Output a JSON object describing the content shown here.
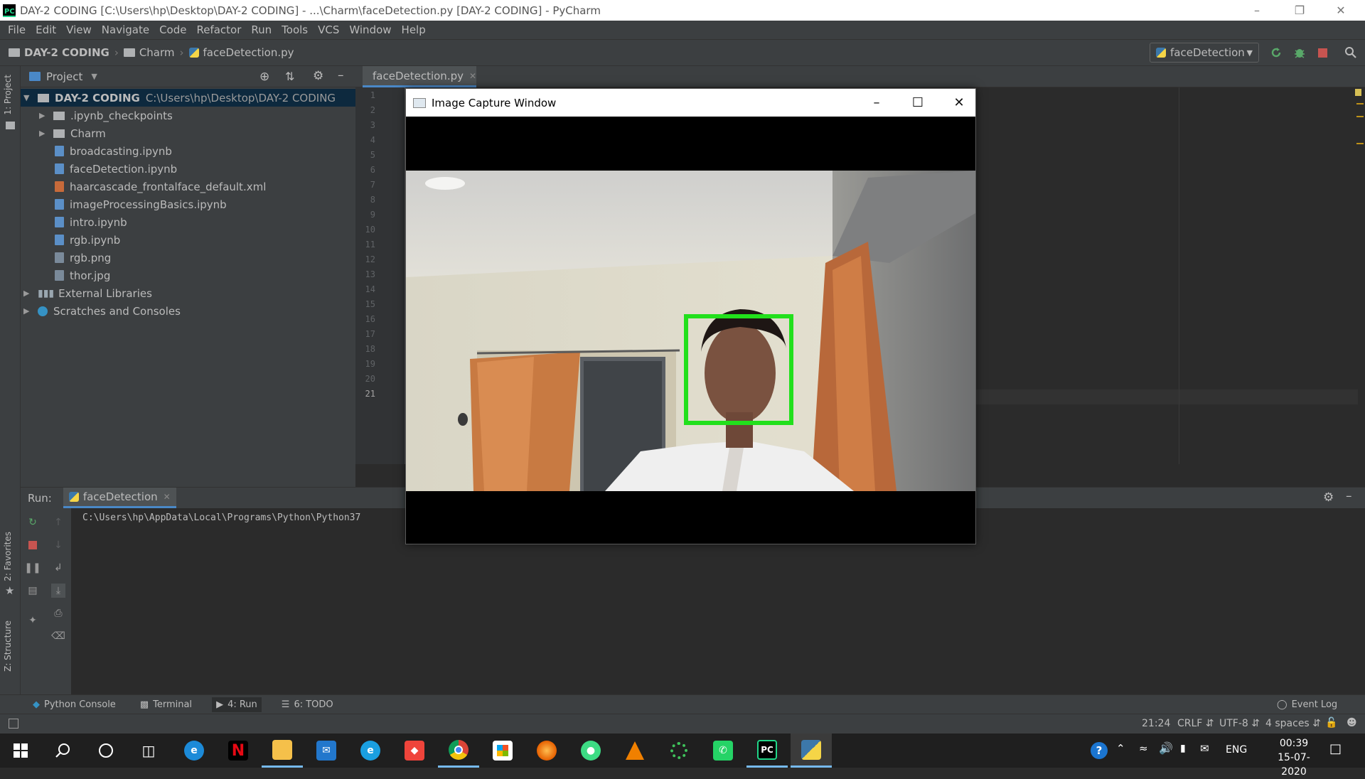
{
  "window": {
    "title": "DAY-2 CODING [C:\\Users\\hp\\Desktop\\DAY-2 CODING] - ...\\Charm\\faceDetection.py [DAY-2 CODING] - PyCharm",
    "logo_text": "PC"
  },
  "menu": [
    "File",
    "Edit",
    "View",
    "Navigate",
    "Code",
    "Refactor",
    "Run",
    "Tools",
    "VCS",
    "Window",
    "Help"
  ],
  "breadcrumb": {
    "project": "DAY-2 CODING",
    "folder": "Charm",
    "file": "faceDetection.py"
  },
  "run_config": "faceDetection",
  "tool_strip": {
    "project": "1: Project",
    "favorites": "2: Favorites",
    "structure": "Z: Structure"
  },
  "project_panel": {
    "title": "Project",
    "root_name": "DAY-2 CODING",
    "root_path": "C:\\Users\\hp\\Desktop\\DAY-2 CODING",
    "items": [
      {
        "label": ".ipynb_checkpoints",
        "kind": "folder"
      },
      {
        "label": "Charm",
        "kind": "folder"
      },
      {
        "label": "broadcasting.ipynb",
        "kind": "ipynb"
      },
      {
        "label": "faceDetection.ipynb",
        "kind": "ipynb"
      },
      {
        "label": "haarcascade_frontalface_default.xml",
        "kind": "xml"
      },
      {
        "label": "imageProcessingBasics.ipynb",
        "kind": "ipynb"
      },
      {
        "label": "intro.ipynb",
        "kind": "ipynb"
      },
      {
        "label": "rgb.ipynb",
        "kind": "ipynb"
      },
      {
        "label": "rgb.png",
        "kind": "image"
      },
      {
        "label": "thor.jpg",
        "kind": "image"
      }
    ],
    "external_libraries": "External Libraries",
    "scratches": "Scratches and Consoles"
  },
  "editor": {
    "tab_label": "faceDetection.py",
    "line_numbers": [
      "1",
      "2",
      "3",
      "4",
      "5",
      "6",
      "7",
      "8",
      "9",
      "10",
      "11",
      "12",
      "13",
      "14",
      "15",
      "16",
      "17",
      "18",
      "19",
      "20",
      "21"
    ]
  },
  "run_panel": {
    "label": "Run:",
    "tab": "faceDetection",
    "console_text": "C:\\Users\\hp\\AppData\\Local\\Programs\\Python\\Python37"
  },
  "bottom_tabs": {
    "python_console": "Python Console",
    "terminal": "Terminal",
    "run": "4: Run",
    "todo": "6: TODO",
    "event_log": "Event Log"
  },
  "status": {
    "position": "21:24",
    "line_sep": "CRLF",
    "encoding": "UTF-8",
    "indent": "4 spaces"
  },
  "capture_window": {
    "title": "Image Capture Window",
    "face_box_color": "#22e01c"
  },
  "taskbar": {
    "language": "ENG",
    "time": "00:39",
    "date": "15-07-2020"
  },
  "colors": {
    "ide_bg": "#2b2b2b",
    "panel_bg": "#3c3f41",
    "selection": "#0d293e",
    "accent": "#4a88c7"
  }
}
